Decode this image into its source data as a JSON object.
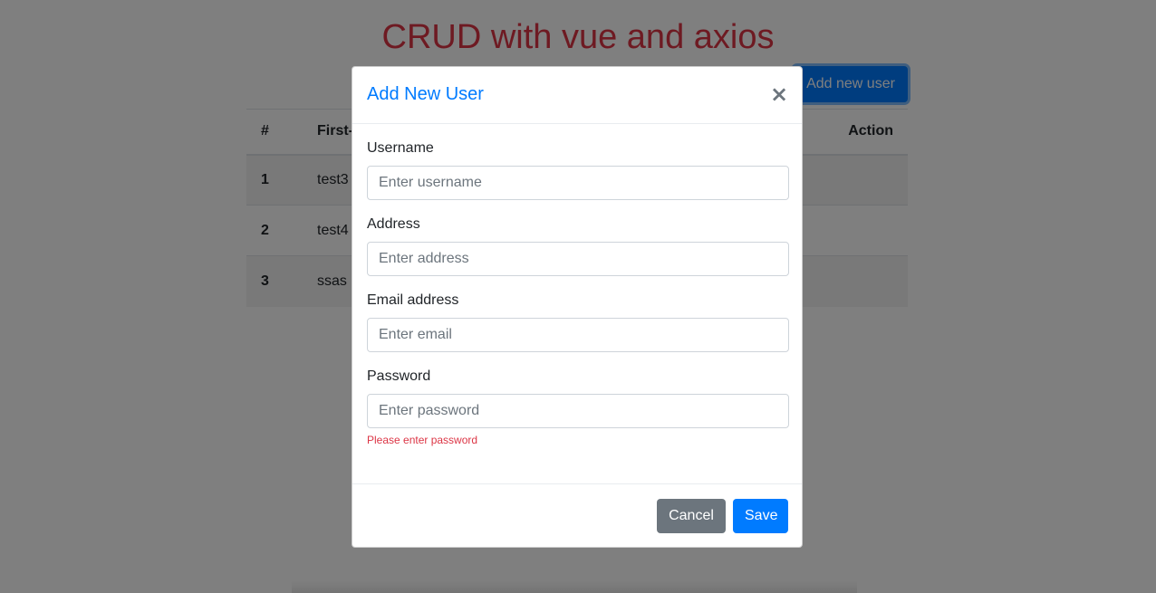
{
  "page": {
    "title": "CRUD with vue and axios",
    "add_button_label": "Add new user"
  },
  "table": {
    "headers": {
      "index": "#",
      "first_name": "First-N",
      "action": "Action"
    },
    "rows": [
      {
        "index": "1",
        "first_name": "test3"
      },
      {
        "index": "2",
        "first_name": "test4"
      },
      {
        "index": "3",
        "first_name": "ssas"
      }
    ],
    "edit_icon": "pencil-icon",
    "delete_icon": "trash-icon"
  },
  "modal": {
    "title": "Add New User",
    "close_label": "×",
    "fields": {
      "username": {
        "label": "Username",
        "placeholder": "Enter username",
        "value": ""
      },
      "address": {
        "label": "Address",
        "placeholder": "Enter address",
        "value": ""
      },
      "email": {
        "label": "Email address",
        "placeholder": "Enter email",
        "value": ""
      },
      "password": {
        "label": "Password",
        "placeholder": "Enter password",
        "value": "",
        "error": "Please enter password"
      }
    },
    "cancel_label": "Cancel",
    "save_label": "Save"
  },
  "colors": {
    "primary": "#007bff",
    "danger": "#dc3545",
    "secondary": "#6c757d"
  }
}
